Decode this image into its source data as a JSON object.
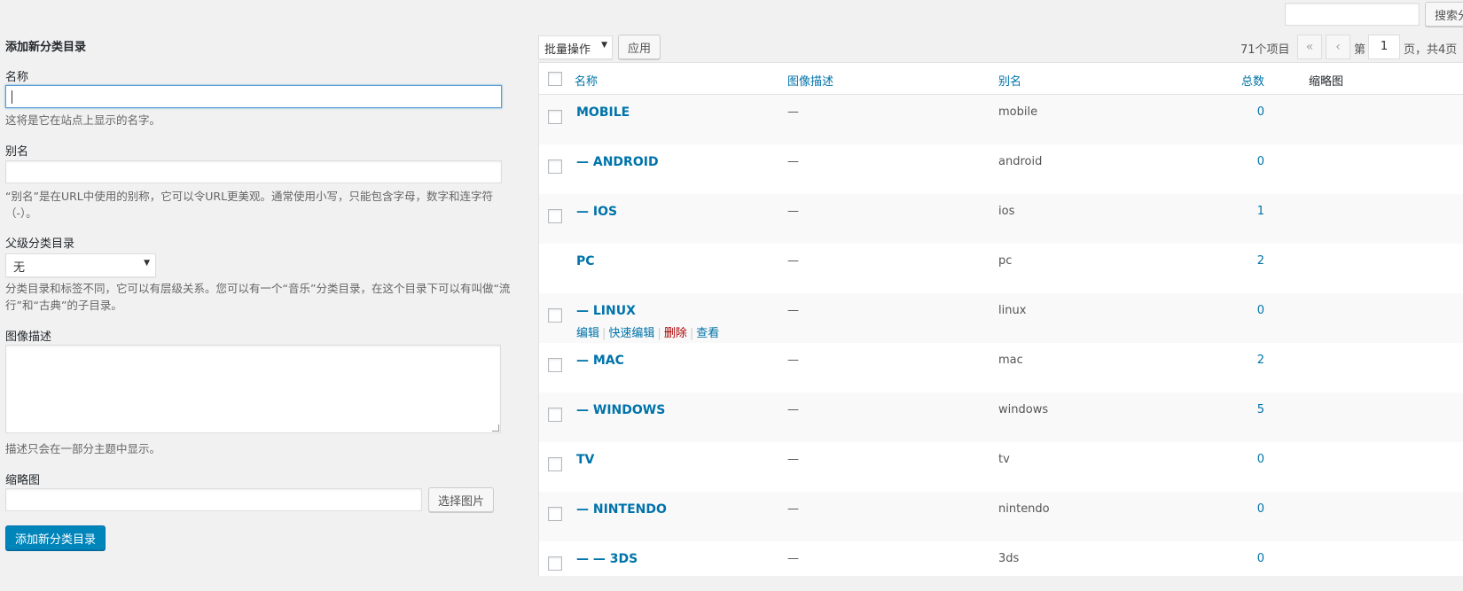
{
  "search": {
    "button_label": "搜索分"
  },
  "form": {
    "title": "添加新分类目录",
    "name_label": "名称",
    "name_desc": "这将是它在站点上显示的名字。",
    "slug_label": "别名",
    "slug_desc_line1": "“别名”是在URL中使用的别称，它可以令URL更美观。通常使用小写，只能包含字母，数字和连字符",
    "slug_desc_line2": "（-）。",
    "parent_label": "父级分类目录",
    "parent_value": "无",
    "parent_desc_line1": "分类目录和标签不同，它可以有层级关系。您可以有一个“音乐”分类目录，在这个目录下可以有叫做“流",
    "parent_desc_line2": "行”和“古典”的子目录。",
    "image_desc_label": "图像描述",
    "image_desc_help": "描述只会在一部分主题中显示。",
    "thumb_label": "缩略图",
    "choose_image_button": "选择图片",
    "submit_button": "添加新分类目录"
  },
  "toolbar": {
    "bulk_action": "批量操作",
    "apply_button": "应用",
    "item_count": "71个项目",
    "first_page": "«",
    "prev_page": "‹",
    "page_prefix": "第",
    "current_page": "1",
    "page_suffix": "页，共4页"
  },
  "table": {
    "columns": {
      "name": "名称",
      "image_desc": "图像描述",
      "slug": "别名",
      "count": "总数",
      "thumb": "缩略图"
    },
    "row_actions": {
      "edit": "编辑",
      "quick_edit": "快速编辑",
      "delete": "删除",
      "view": "查看"
    },
    "rows": [
      {
        "name": "MOBILE",
        "desc": "—",
        "slug": "mobile",
        "count": "0"
      },
      {
        "name": "— ANDROID",
        "desc": "—",
        "slug": "android",
        "count": "0"
      },
      {
        "name": "— IOS",
        "desc": "—",
        "slug": "ios",
        "count": "1"
      },
      {
        "name": "PC",
        "desc": "—",
        "slug": "pc",
        "count": "2"
      },
      {
        "name": "— LINUX",
        "desc": "—",
        "slug": "linux",
        "count": "0"
      },
      {
        "name": "— MAC",
        "desc": "—",
        "slug": "mac",
        "count": "2"
      },
      {
        "name": "— WINDOWS",
        "desc": "—",
        "slug": "windows",
        "count": "5"
      },
      {
        "name": "TV",
        "desc": "—",
        "slug": "tv",
        "count": "0"
      },
      {
        "name": "— NINTENDO",
        "desc": "—",
        "slug": "nintendo",
        "count": "0"
      },
      {
        "name": "— — 3DS",
        "desc": "—",
        "slug": "3ds",
        "count": "0"
      }
    ]
  },
  "colors": {
    "link": "#0073aa",
    "primary_button": "#0085ba",
    "delete": "#aa0000",
    "background": "#f1f1f1"
  }
}
